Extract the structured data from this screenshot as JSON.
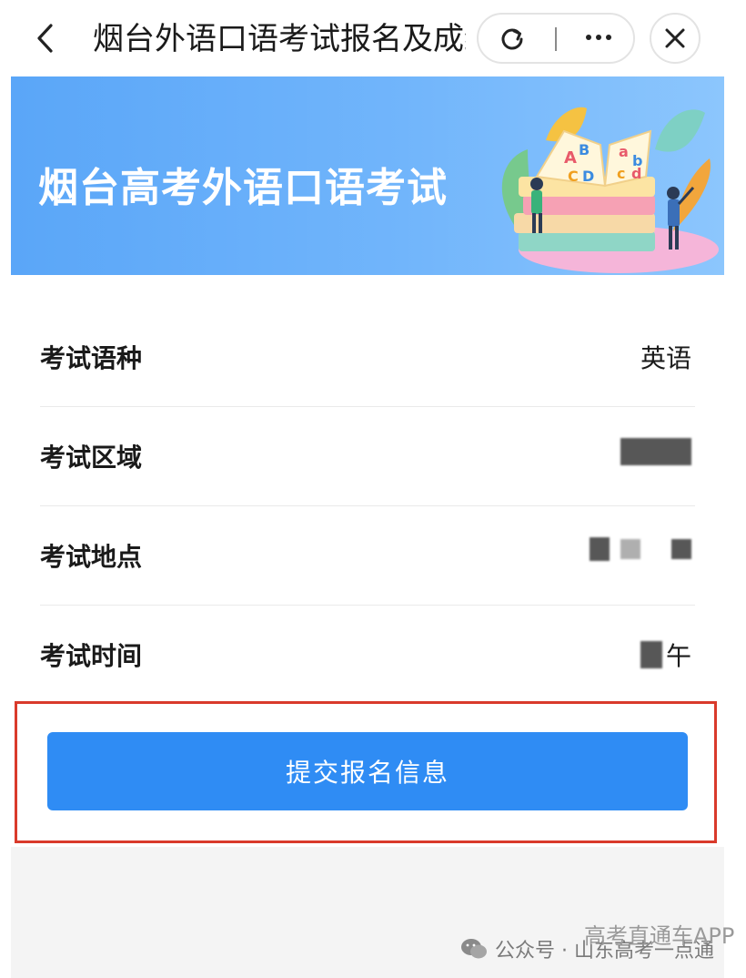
{
  "nav": {
    "title": "烟台外语口语考试报名及成绩",
    "back_icon": "chevron-left-icon",
    "refresh_icon": "refresh-icon",
    "more_icon": "more-horizontal-icon",
    "close_icon": "close-icon"
  },
  "banner": {
    "title": "烟台高考外语口语考试",
    "illustration_letters": [
      "A",
      "B",
      "a",
      "C",
      "D",
      "b",
      "c",
      "d"
    ]
  },
  "form": {
    "rows": [
      {
        "label": "考试语种",
        "value": "英语"
      },
      {
        "label": "考试区域",
        "value": ""
      },
      {
        "label": "考试地点",
        "value": ""
      },
      {
        "label": "考试时间",
        "value": "午"
      }
    ]
  },
  "submit": {
    "label": "提交报名信息"
  },
  "watermark": {
    "prefix": "公众号 · 山东高考一点通",
    "brand": "高考直通车APP"
  },
  "colors": {
    "accent": "#2f8cf4",
    "banner_start": "#5aa6f8",
    "highlight_border": "#d93a2b"
  }
}
